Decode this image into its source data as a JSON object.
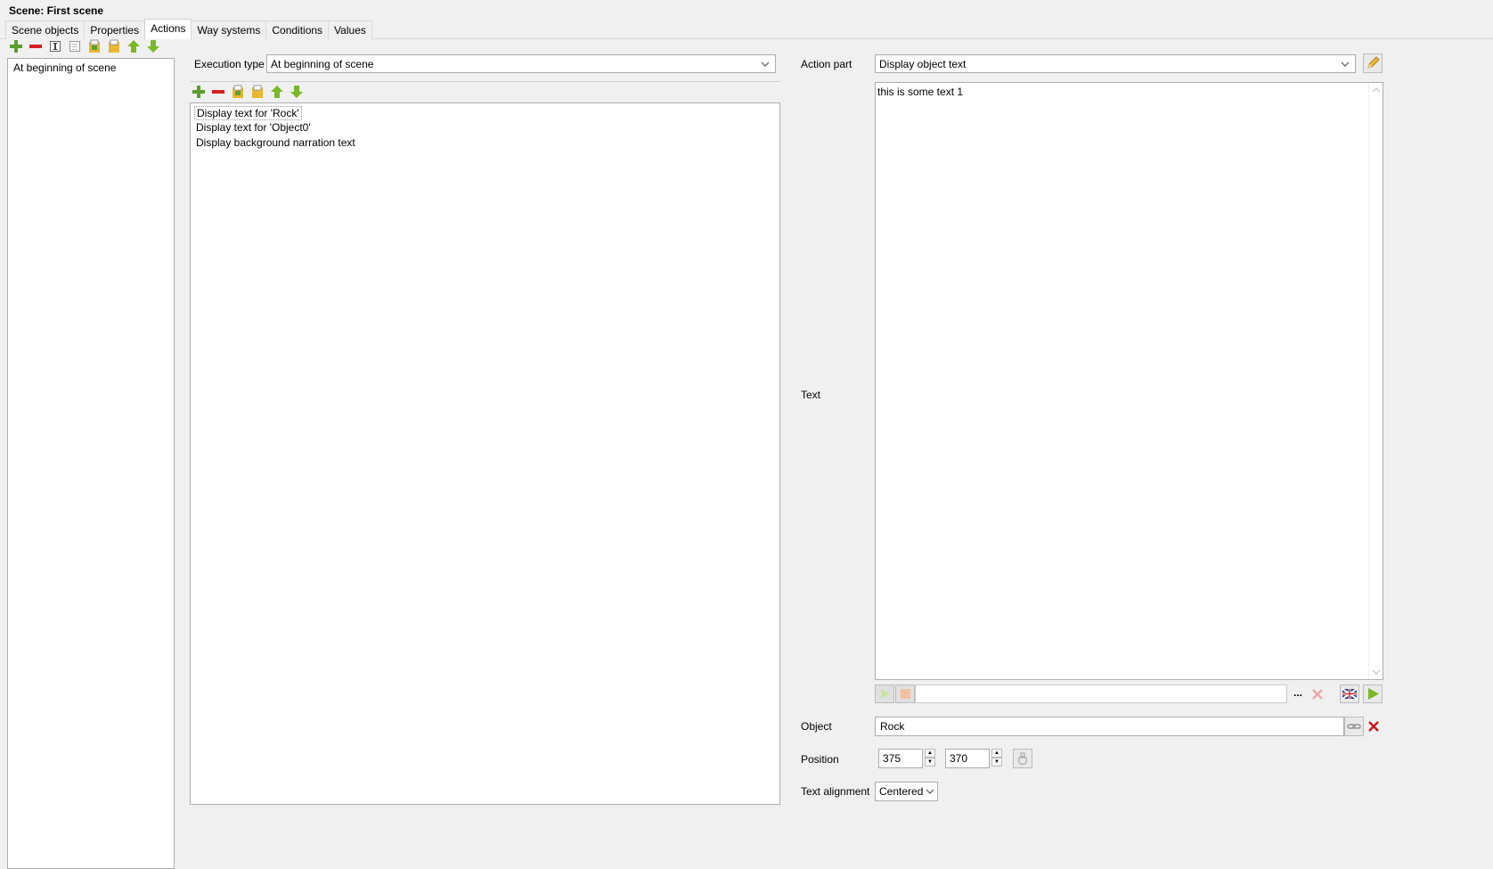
{
  "window": {
    "title": "Scene: First scene"
  },
  "tabs": [
    {
      "label": "Scene objects",
      "active": false
    },
    {
      "label": "Properties",
      "active": false
    },
    {
      "label": "Actions",
      "active": true
    },
    {
      "label": "Way systems",
      "active": false
    },
    {
      "label": "Conditions",
      "active": false
    },
    {
      "label": "Values",
      "active": false
    }
  ],
  "left_toolbar": [
    "add-icon",
    "remove-icon",
    "rename-icon",
    "copy-icon",
    "paste-icon",
    "paste-into-icon",
    "move-up-icon",
    "move-down-icon"
  ],
  "actions_list": {
    "items": [
      "At beginning of scene"
    ]
  },
  "execution": {
    "label": "Execution type",
    "value": "At beginning of scene"
  },
  "middle_toolbar": [
    "add-icon",
    "remove-icon",
    "copy-icon",
    "paste-icon",
    "move-up-icon",
    "move-down-icon"
  ],
  "action_parts": {
    "items": [
      "Display text for 'Rock'",
      "Display text for 'Object0'",
      "Display background narration text"
    ]
  },
  "action_part": {
    "label": "Action part",
    "value": "Display object text"
  },
  "text": {
    "label": "Text",
    "value": "this is some text 1"
  },
  "object": {
    "label": "Object",
    "value": "Rock"
  },
  "position": {
    "label": "Position",
    "x": "375",
    "y": "370"
  },
  "alignment": {
    "label": "Text alignment",
    "value": "Centered"
  },
  "colors": {
    "green": "#5aa02c",
    "red": "#d42020",
    "folder": "#e8b830"
  }
}
